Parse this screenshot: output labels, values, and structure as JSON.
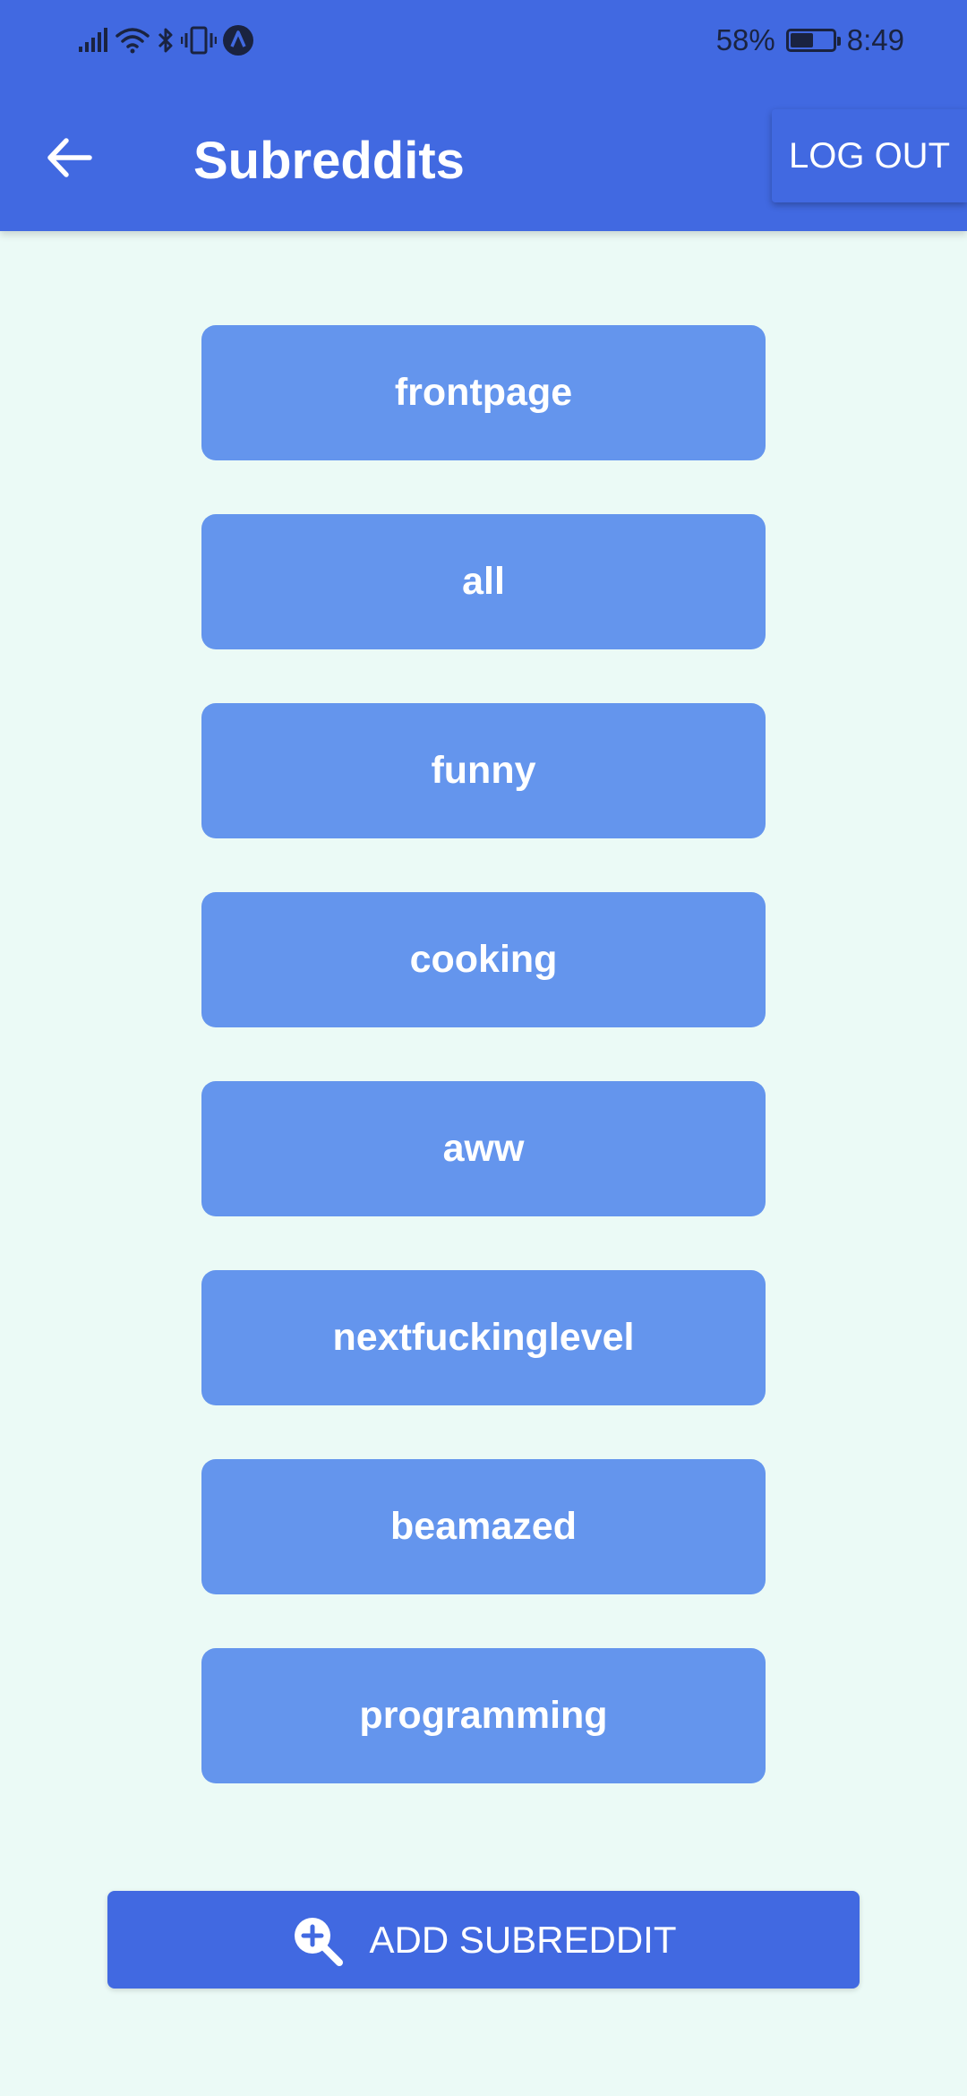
{
  "status_bar": {
    "battery_text": "58%",
    "battery_level": 0.58,
    "time": "8:49",
    "icons": [
      "signal-icon",
      "wifi-icon",
      "bluetooth-icon",
      "vibrate-icon",
      "navigation-icon"
    ]
  },
  "app_bar": {
    "title": "Subreddits",
    "back_icon": "arrow-left-icon",
    "logout_label": "LOG OUT"
  },
  "subreddits": [
    {
      "label": "frontpage"
    },
    {
      "label": "all"
    },
    {
      "label": "funny"
    },
    {
      "label": "cooking"
    },
    {
      "label": "aww"
    },
    {
      "label": "nextfuckinglevel"
    },
    {
      "label": "beamazed"
    },
    {
      "label": "programming"
    }
  ],
  "add_button": {
    "label": "ADD SUBREDDIT",
    "icon": "zoom-plus-icon"
  },
  "colors": {
    "header": "#4169e1",
    "background": "#ebfaf6",
    "subreddit_button": "#6495ed",
    "add_button": "#4169e1",
    "text_on_button": "#ffffff"
  }
}
